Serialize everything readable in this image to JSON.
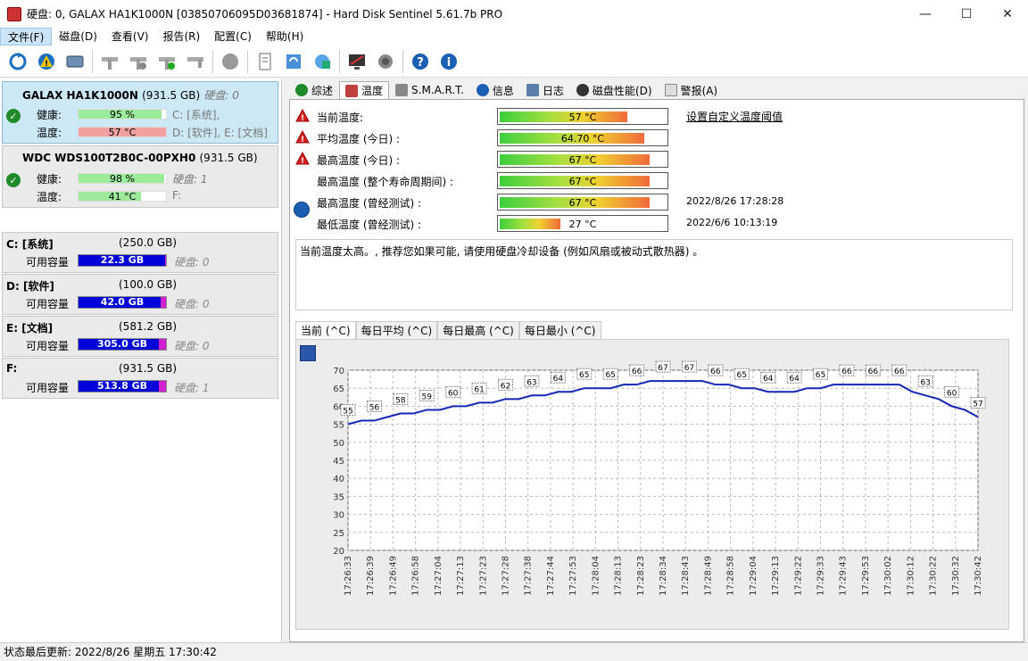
{
  "window": {
    "title": "硬盘:  0, GALAX HA1K1000N [03850706095D03681874]  -  Hard Disk Sentinel 5.61.7b PRO",
    "min": "—",
    "max": "☐",
    "close": "✕"
  },
  "menu": [
    "文件(F)",
    "磁盘(D)",
    "查看(V)",
    "报告(R)",
    "配置(C)",
    "帮助(H)"
  ],
  "disks": [
    {
      "name": "GALAX HA1K1000N",
      "size": "(931.5 GB)",
      "hd": "硬盘: 0",
      "health_label": "健康:",
      "health": "95 %",
      "health_pct": 95,
      "temp_label": "温度:",
      "temp": "57 °C",
      "temp_pct": 57,
      "partitions_line1": "C: [系统],",
      "partitions_line2": "D: [软件], E: [文档]"
    },
    {
      "name": "WDC WDS100T2B0C-00PXH0",
      "size": "(931.5 GB)",
      "hd": "硬盘: 1",
      "health_label": "健康:",
      "health": "98 %",
      "health_pct": 98,
      "temp_label": "温度:",
      "temp": "41 °C",
      "temp_pct": 41,
      "partitions_line1": "F:",
      "partitions_line2": ""
    }
  ],
  "partitions": [
    {
      "name": "C: [系统]",
      "size": "(250.0 GB)",
      "free_label": "可用容量",
      "free": "22.3 GB",
      "free_pct": 0.089,
      "hd": "硬盘: 0"
    },
    {
      "name": "D: [软件]",
      "size": "(100.0 GB)",
      "free_label": "可用容量",
      "free": "42.0 GB",
      "free_pct": 0.42,
      "hd": "硬盘: 0"
    },
    {
      "name": "E: [文档]",
      "size": "(581.2 GB)",
      "free_label": "可用容量",
      "free": "305.0 GB",
      "free_pct": 0.525,
      "hd": "硬盘: 0"
    },
    {
      "name": "F:",
      "size": "(931.5 GB)",
      "free_label": "可用容量",
      "free": "513.8 GB",
      "free_pct": 0.552,
      "hd": "硬盘: 1"
    }
  ],
  "tabs": [
    "综述",
    "温度",
    "S.M.A.R.T.",
    "信息",
    "日志",
    "磁盘性能(D)",
    "警报(A)"
  ],
  "temps": [
    {
      "label": "当前温度:",
      "value": "57 °C",
      "pct": 0.57,
      "warn": true,
      "date": ""
    },
    {
      "label": "平均温度 (今日) :",
      "value": "64.70 °C",
      "pct": 0.647,
      "warn": true,
      "date": ""
    },
    {
      "label": "最高温度 (今日) :",
      "value": "67 °C",
      "pct": 0.67,
      "warn": true,
      "date": ""
    },
    {
      "label": "最高温度 (整个寿命周期间) :",
      "value": "67 °C",
      "pct": 0.67,
      "warn": false,
      "date": ""
    },
    {
      "label": "最高温度 (曾经测试) :",
      "value": "67 °C",
      "pct": 0.67,
      "warn": false,
      "date": "2022/8/26 17:28:28"
    },
    {
      "label": "最低温度 (曾经测试) :",
      "value": "27 °C",
      "pct": 0.27,
      "warn": false,
      "date": "2022/6/6 10:13:19"
    }
  ],
  "set_threshold_link": "设置自定义温度阈值",
  "message": "当前温度太高。, 推荐您如果可能, 请使用硬盘冷却设备 (例如风扇或被动式散热器) 。",
  "subtabs": [
    "当前 (^C)",
    "每日平均 (^C)",
    "每日最高 (^C)",
    "每日最小 (^C)"
  ],
  "chart_data": {
    "type": "line",
    "ylim": [
      20,
      70
    ],
    "yticks": [
      20,
      25,
      30,
      35,
      40,
      45,
      50,
      55,
      60,
      65,
      70
    ],
    "xticks": [
      "17:26:33",
      "17:26:39",
      "17:26:49",
      "17:26:58",
      "17:27:04",
      "17:27:13",
      "17:27:23",
      "17:27:28",
      "17:27:38",
      "17:27:44",
      "17:27:53",
      "17:28:04",
      "17:28:13",
      "17:28:23",
      "17:28:34",
      "17:28:43",
      "17:28:49",
      "17:28:58",
      "17:29:04",
      "17:29:13",
      "17:29:22",
      "17:29:33",
      "17:29:43",
      "17:29:53",
      "17:30:02",
      "17:30:12",
      "17:30:22",
      "17:30:32",
      "17:30:42"
    ],
    "values": [
      55,
      56,
      56,
      57,
      58,
      58,
      59,
      59,
      60,
      60,
      61,
      61,
      62,
      62,
      63,
      63,
      64,
      64,
      65,
      65,
      65,
      66,
      66,
      67,
      67,
      67,
      67,
      67,
      66,
      66,
      65,
      65,
      64,
      64,
      64,
      65,
      65,
      66,
      66,
      66,
      66,
      66,
      66,
      64,
      63,
      62,
      60,
      59,
      57
    ]
  },
  "status": "状态最后更新:   2022/8/26 星期五 17:30:42"
}
